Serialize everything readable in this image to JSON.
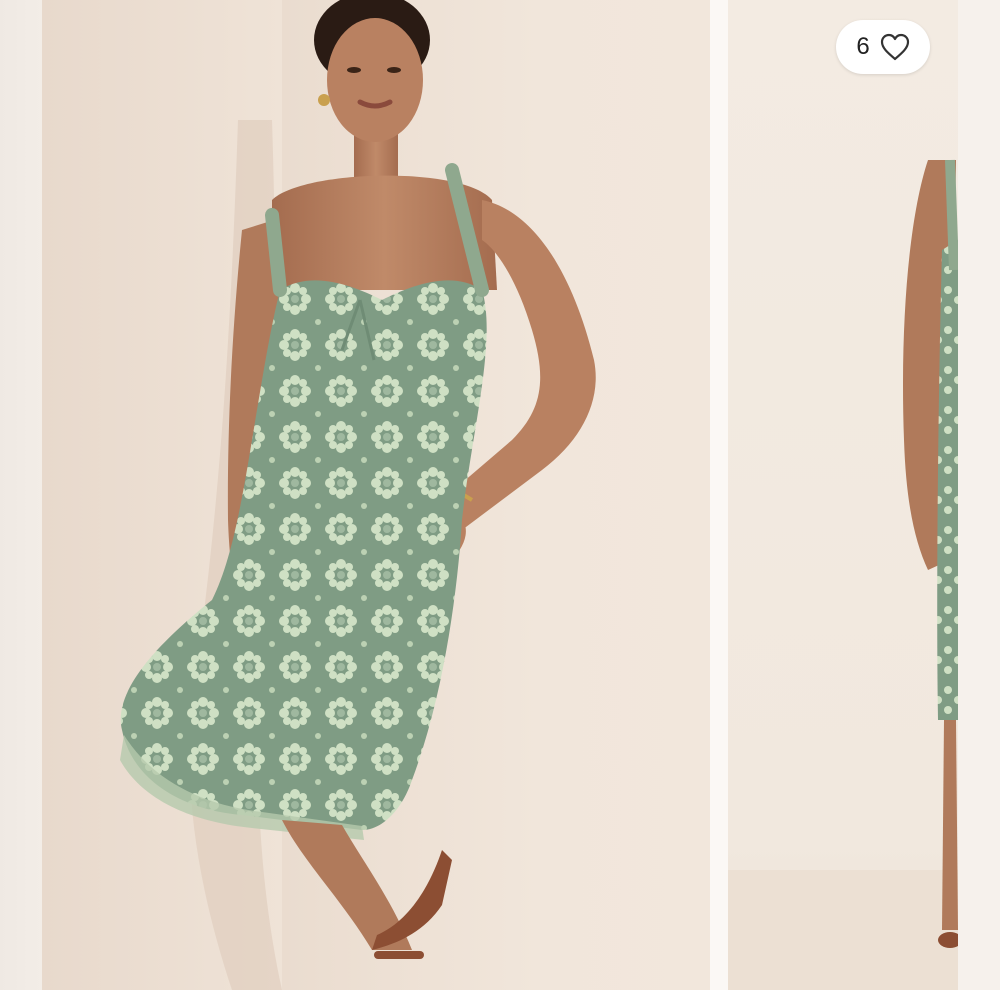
{
  "listing": {
    "like_count": "6",
    "colors": {
      "wall": "#efe3d7",
      "dress": "#7f9c84",
      "lace": "#c9dcbf",
      "skin": "#b98161",
      "sandal": "#8c4e33",
      "pill": "#ffffff"
    },
    "icons": {
      "like": "heart-outline-icon"
    }
  }
}
